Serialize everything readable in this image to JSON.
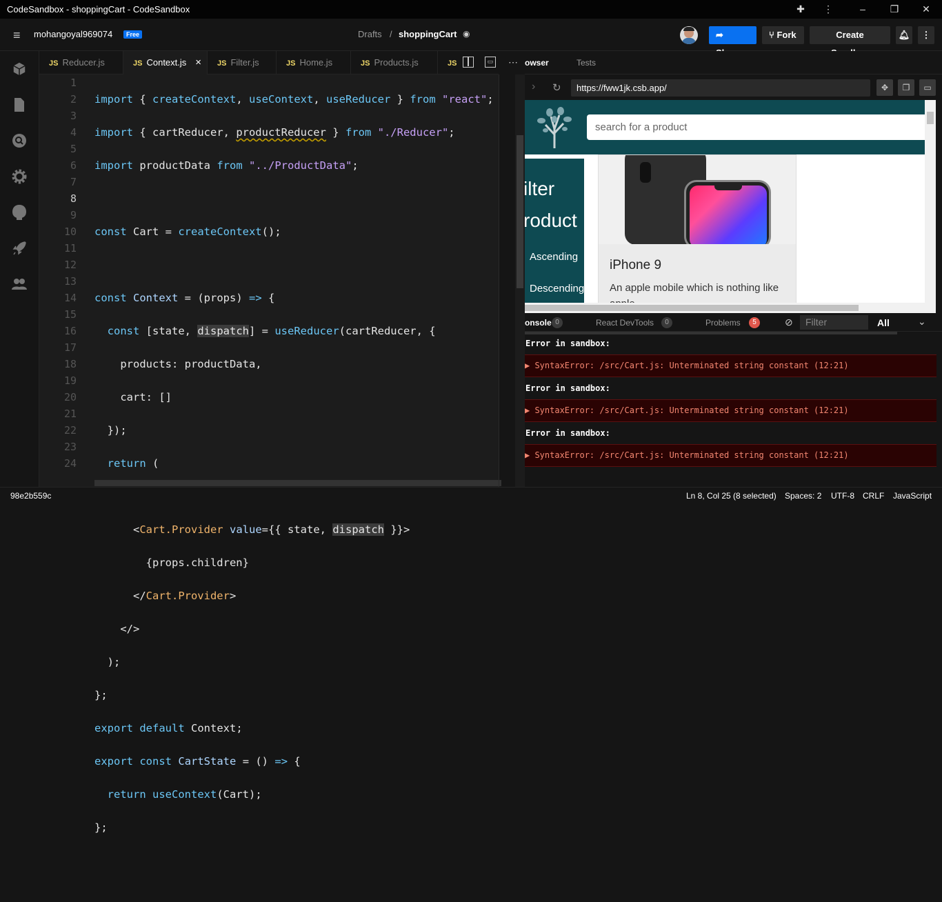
{
  "window": {
    "title": "CodeSandbox - shoppingCart - CodeSandbox"
  },
  "header": {
    "username": "mohangoyal969074",
    "plan_badge": "Free",
    "breadcrumb_parent": "Drafts",
    "breadcrumb_sep": "/",
    "sandbox_name": "shoppingCart",
    "share_label": "Share",
    "fork_label": "Fork",
    "create_label": "Create Sandbox"
  },
  "tabs": [
    {
      "label": "Reducer.js",
      "icon": "JS"
    },
    {
      "label": "Context.js",
      "icon": "JS",
      "close": "×"
    },
    {
      "label": "Filter.js",
      "icon": "JS"
    },
    {
      "label": "Home.js",
      "icon": "JS"
    },
    {
      "label": "Products.js",
      "icon": "JS"
    },
    {
      "label": "",
      "icon": "JS"
    }
  ],
  "preview_tabs": {
    "browser": "owser",
    "tests": "Tests"
  },
  "browser": {
    "url": "https://fww1jk.csb.app/"
  },
  "app": {
    "search_placeholder": "search for a product",
    "filter_title_1": "ilter",
    "filter_title_2": "roduct",
    "sort_asc": "Ascending",
    "sort_desc": "Descending",
    "product_name": "iPhone 9",
    "product_desc": "An apple mobile which is nothing like apple"
  },
  "console": {
    "tab_console": "onsole",
    "console_count": "0",
    "tab_devtools": "React DevTools",
    "devtools_count": "0",
    "tab_problems": "Problems",
    "problems_count": "5",
    "filter_placeholder": "Filter",
    "level": "All",
    "error_label": "Error in sandbox:",
    "error_msg": "▶ SyntaxError: /src/Cart.js: Unterminated string constant (12:21)"
  },
  "status": {
    "commit": "98e2b559c",
    "position": "Ln 8, Col 25 (8 selected)",
    "spaces": "Spaces: 2",
    "encoding": "UTF-8",
    "eol": "CRLF",
    "language": "JavaScript"
  },
  "code": {
    "line_numbers": [
      "1",
      "2",
      "3",
      "4",
      "5",
      "6",
      "7",
      "8",
      "9",
      "10",
      "11",
      "12",
      "13",
      "14",
      "15",
      "16",
      "17",
      "18",
      "19",
      "20",
      "21",
      "22",
      "23",
      "24"
    ]
  }
}
